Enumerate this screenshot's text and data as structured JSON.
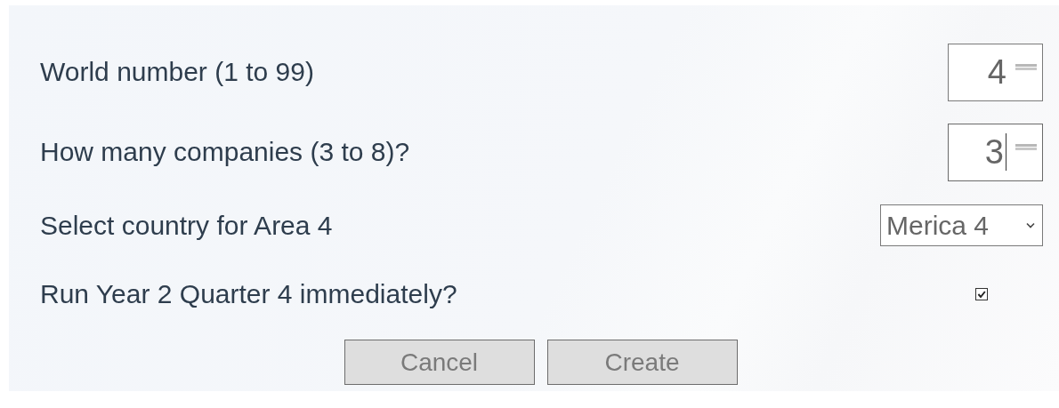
{
  "form": {
    "rows": [
      {
        "kind": "number",
        "label": "World number (1 to 99)",
        "value": "4",
        "focused": false
      },
      {
        "kind": "number",
        "label": "How many companies (3 to 8)?",
        "value": "3",
        "focused": true
      },
      {
        "kind": "select",
        "label": "Select country for Area 4",
        "value": "Merica 4"
      },
      {
        "kind": "checkbox",
        "label": "Run Year 2 Quarter 4 immediately?",
        "checked": true
      }
    ],
    "buttons": [
      {
        "label": "Cancel",
        "disabled": true
      },
      {
        "label": "Create",
        "disabled": true
      }
    ]
  }
}
